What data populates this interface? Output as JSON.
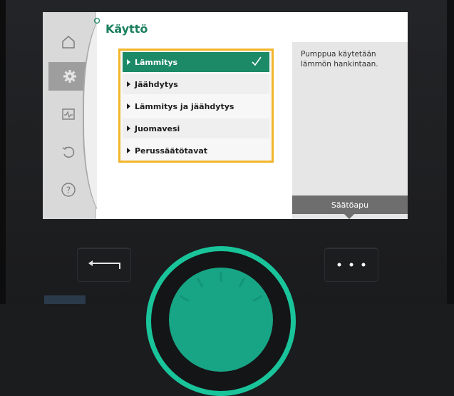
{
  "screen": {
    "title": "Käyttö",
    "menu_items": [
      {
        "label": "Lämmitys",
        "selected": true
      },
      {
        "label": "Jäähdytys",
        "selected": false
      },
      {
        "label": "Lämmitys ja jäähdytys",
        "selected": false
      },
      {
        "label": "Juomavesi",
        "selected": false
      },
      {
        "label": "Perussäätötavat",
        "selected": false
      }
    ],
    "help_text": "Pumppua käytetään lämmön hankintaan.",
    "help_button_label": "Säätöapu"
  },
  "sidebar": {
    "items": [
      {
        "icon": "home-icon"
      },
      {
        "icon": "gear-icon",
        "active": true
      },
      {
        "icon": "diagnostics-icon"
      },
      {
        "icon": "restore-icon"
      },
      {
        "icon": "help-icon"
      }
    ]
  },
  "device": {
    "back_button_icon": "back-arrow-icon",
    "context_button_icon": "more-dots-icon",
    "accent_color": "#1c8a67",
    "focus_color": "#f2b52a"
  }
}
